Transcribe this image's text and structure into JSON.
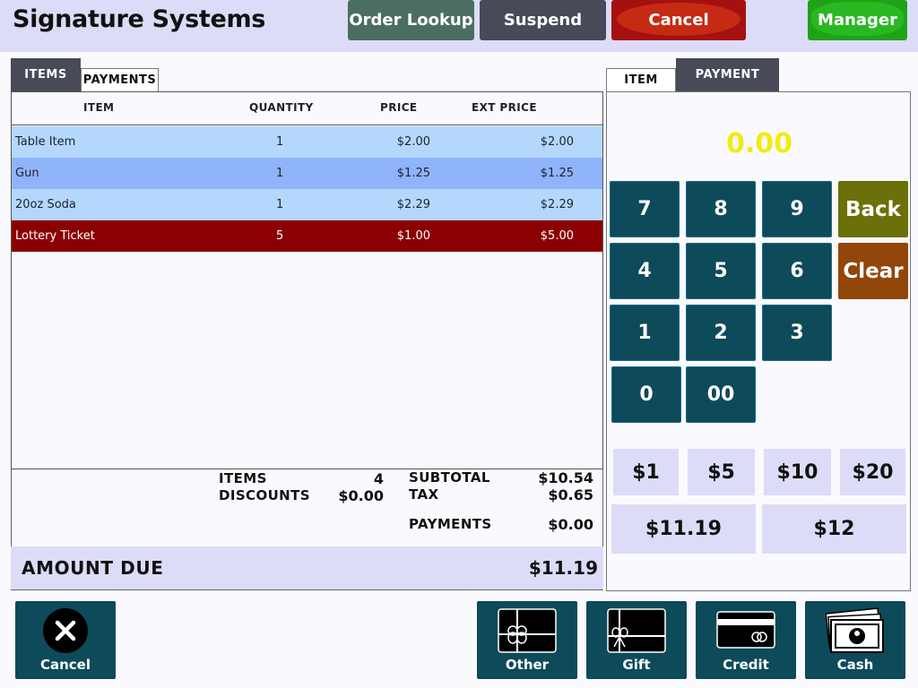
{
  "header": {
    "title": "Signature Systems",
    "order_lookup": "Order Lookup",
    "suspend": "Suspend",
    "cancel": "Cancel",
    "manager": "Manager"
  },
  "left_tabs": [
    "ITEMS",
    "PAYMENTS"
  ],
  "columns": [
    "ITEM",
    "QUANTITY",
    "PRICE",
    "EXT PRICE"
  ],
  "rows": [
    {
      "item": "Table Item",
      "quantity": "1",
      "price": "$2.00",
      "ext_price": "$2.00"
    },
    {
      "item": "Gun",
      "quantity": "1",
      "price": "$1.25",
      "ext_price": "$1.25"
    },
    {
      "item": "20oz Soda",
      "quantity": "1",
      "price": "$2.29",
      "ext_price": "$2.29"
    },
    {
      "item": "Lottery Ticket",
      "quantity": "5",
      "price": "$1.00",
      "ext_price": "$5.00"
    }
  ],
  "row_colors": [
    "#b4d8fc",
    "#8fb4fa",
    "#b4d8fc",
    "#8b0000"
  ],
  "totals": {
    "items_label": "ITEMS",
    "items_value": "4",
    "discounts_label": "DISCOUNTS",
    "discounts_value": "$0.00",
    "subtotal_label": "SUBTOTAL",
    "subtotal_value": "$10.54",
    "tax_label": "TAX",
    "tax_value": "$0.65",
    "payments_label": "PAYMENTS",
    "payments_value": "$0.00",
    "amount_due_label": "AMOUNT DUE",
    "amount_due_value": "$11.19"
  },
  "right_tabs": [
    "ITEM",
    "PAYMENT"
  ],
  "entry_display": "0.00",
  "keypad": {
    "k7": "7",
    "k8": "8",
    "k9": "9",
    "back": "Back",
    "k4": "4",
    "k5": "5",
    "k6": "6",
    "clear": "Clear",
    "k1": "1",
    "k2": "2",
    "k3": "3",
    "k0": "0",
    "k00": "00"
  },
  "quick_amounts": [
    "$1",
    "$5",
    "$10",
    "$20",
    "$11.19",
    "$12"
  ],
  "bottom_buttons": {
    "cancel": "Cancel",
    "other": "Other",
    "gift": "Gift",
    "credit": "Credit",
    "cash": "Cash"
  },
  "colors": {
    "header_bg": "#dcdcf8",
    "keypad_bg": "#0d4a5a",
    "entry_display": "#f0ec10",
    "lottery_row": "#8b0000"
  },
  "icons": {
    "cancel": "close-circle-icon",
    "other": "gift-box-icon",
    "gift": "gift-card-icon",
    "credit": "credit-card-icon",
    "cash": "cash-bills-icon"
  }
}
